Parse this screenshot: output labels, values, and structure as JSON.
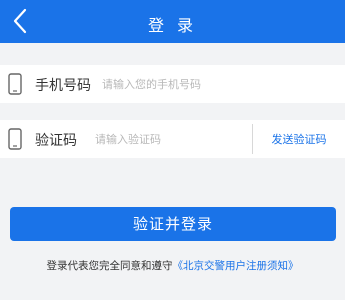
{
  "header": {
    "title": "登 录",
    "back_icon": "chevron-left-icon"
  },
  "phone_row": {
    "icon": "phone-icon",
    "label": "手机号码",
    "placeholder": "请输入您的手机号码",
    "value": ""
  },
  "code_row": {
    "icon": "phone-icon",
    "label": "验证码",
    "placeholder": "请输入验证码",
    "value": "",
    "send_label": "发送验证码"
  },
  "login_button": {
    "label": "验证并登录"
  },
  "agreement": {
    "text": "登录代表您完全同意和遵守",
    "link": "《北京交警用户注册须知》"
  },
  "colors": {
    "primary": "#1a73e8",
    "background": "#f2f3f5",
    "placeholder": "#b8b8b8"
  }
}
